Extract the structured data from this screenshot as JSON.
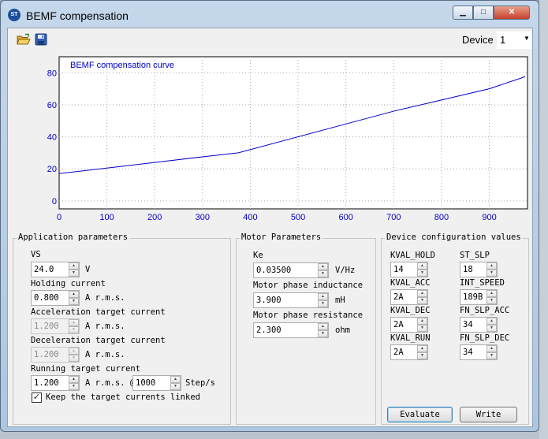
{
  "window": {
    "title": "BEMF compensation",
    "icon_text": "ST"
  },
  "controls": {
    "minimize": "▁",
    "maximize": "□",
    "close": "✕"
  },
  "toolbar": {
    "device_label": "Device",
    "device_value": "1"
  },
  "chart_data": {
    "type": "line",
    "title": "BEMF compensation curve",
    "x": [
      0,
      100,
      200,
      300,
      375,
      500,
      600,
      700,
      800,
      900,
      975
    ],
    "series": [
      {
        "values": [
          17,
          20.5,
          24,
          27.5,
          30,
          40,
          48,
          56,
          63,
          70,
          77.5
        ]
      }
    ],
    "xticks": [
      0,
      100,
      200,
      300,
      400,
      500,
      600,
      700,
      800,
      900
    ],
    "yticks": [
      0,
      20,
      40,
      60,
      80
    ],
    "xlim": [
      0,
      980
    ],
    "ylim": [
      -5,
      90
    ],
    "grid": true,
    "line_color": "#0000c8",
    "label_color": "#0000c8"
  },
  "app_params": {
    "title": "Application parameters",
    "vs": {
      "label": "VS",
      "value": "24.0",
      "unit": "V"
    },
    "holding": {
      "label": "Holding current",
      "value": "0.800",
      "unit": "A r.m.s."
    },
    "accel": {
      "label": "Acceleration target current",
      "value": "1.200",
      "unit": "A r.m.s."
    },
    "decel": {
      "label": "Deceleration target current",
      "value": "1.200",
      "unit": "A r.m.s."
    },
    "running": {
      "label": "Running target current",
      "value": "1.200",
      "unit": "A r.m.s. @",
      "speed": "1000",
      "speed_unit": "Step/s"
    },
    "linked": {
      "label": "Keep the target currents linked",
      "checked": "✓"
    }
  },
  "motor_params": {
    "title": "Motor Parameters",
    "ke": {
      "label": "Ke",
      "value": "0.03500",
      "unit": "V/Hz"
    },
    "inductance": {
      "label": "Motor phase inductance",
      "value": "3.900",
      "unit": "mH"
    },
    "resistance": {
      "label": "Motor phase resistance",
      "value": "2.300",
      "unit": "ohm"
    }
  },
  "device_config": {
    "title": "Device configuration values",
    "kval_hold": {
      "label": "KVAL_HOLD",
      "value": "14"
    },
    "kval_acc": {
      "label": "KVAL_ACC",
      "value": "2A"
    },
    "kval_dec": {
      "label": "KVAL_DEC",
      "value": "2A"
    },
    "kval_run": {
      "label": "KVAL_RUN",
      "value": "2A"
    },
    "st_slp": {
      "label": "ST_SLP",
      "value": "18"
    },
    "int_speed": {
      "label": "INT_SPEED",
      "value": "189B"
    },
    "fn_slp_acc": {
      "label": "FN_SLP_ACC",
      "value": "34"
    },
    "fn_slp_dec": {
      "label": "FN_SLP_DEC",
      "value": "34"
    },
    "evaluate_label": "Evaluate",
    "write_label": "Write"
  }
}
